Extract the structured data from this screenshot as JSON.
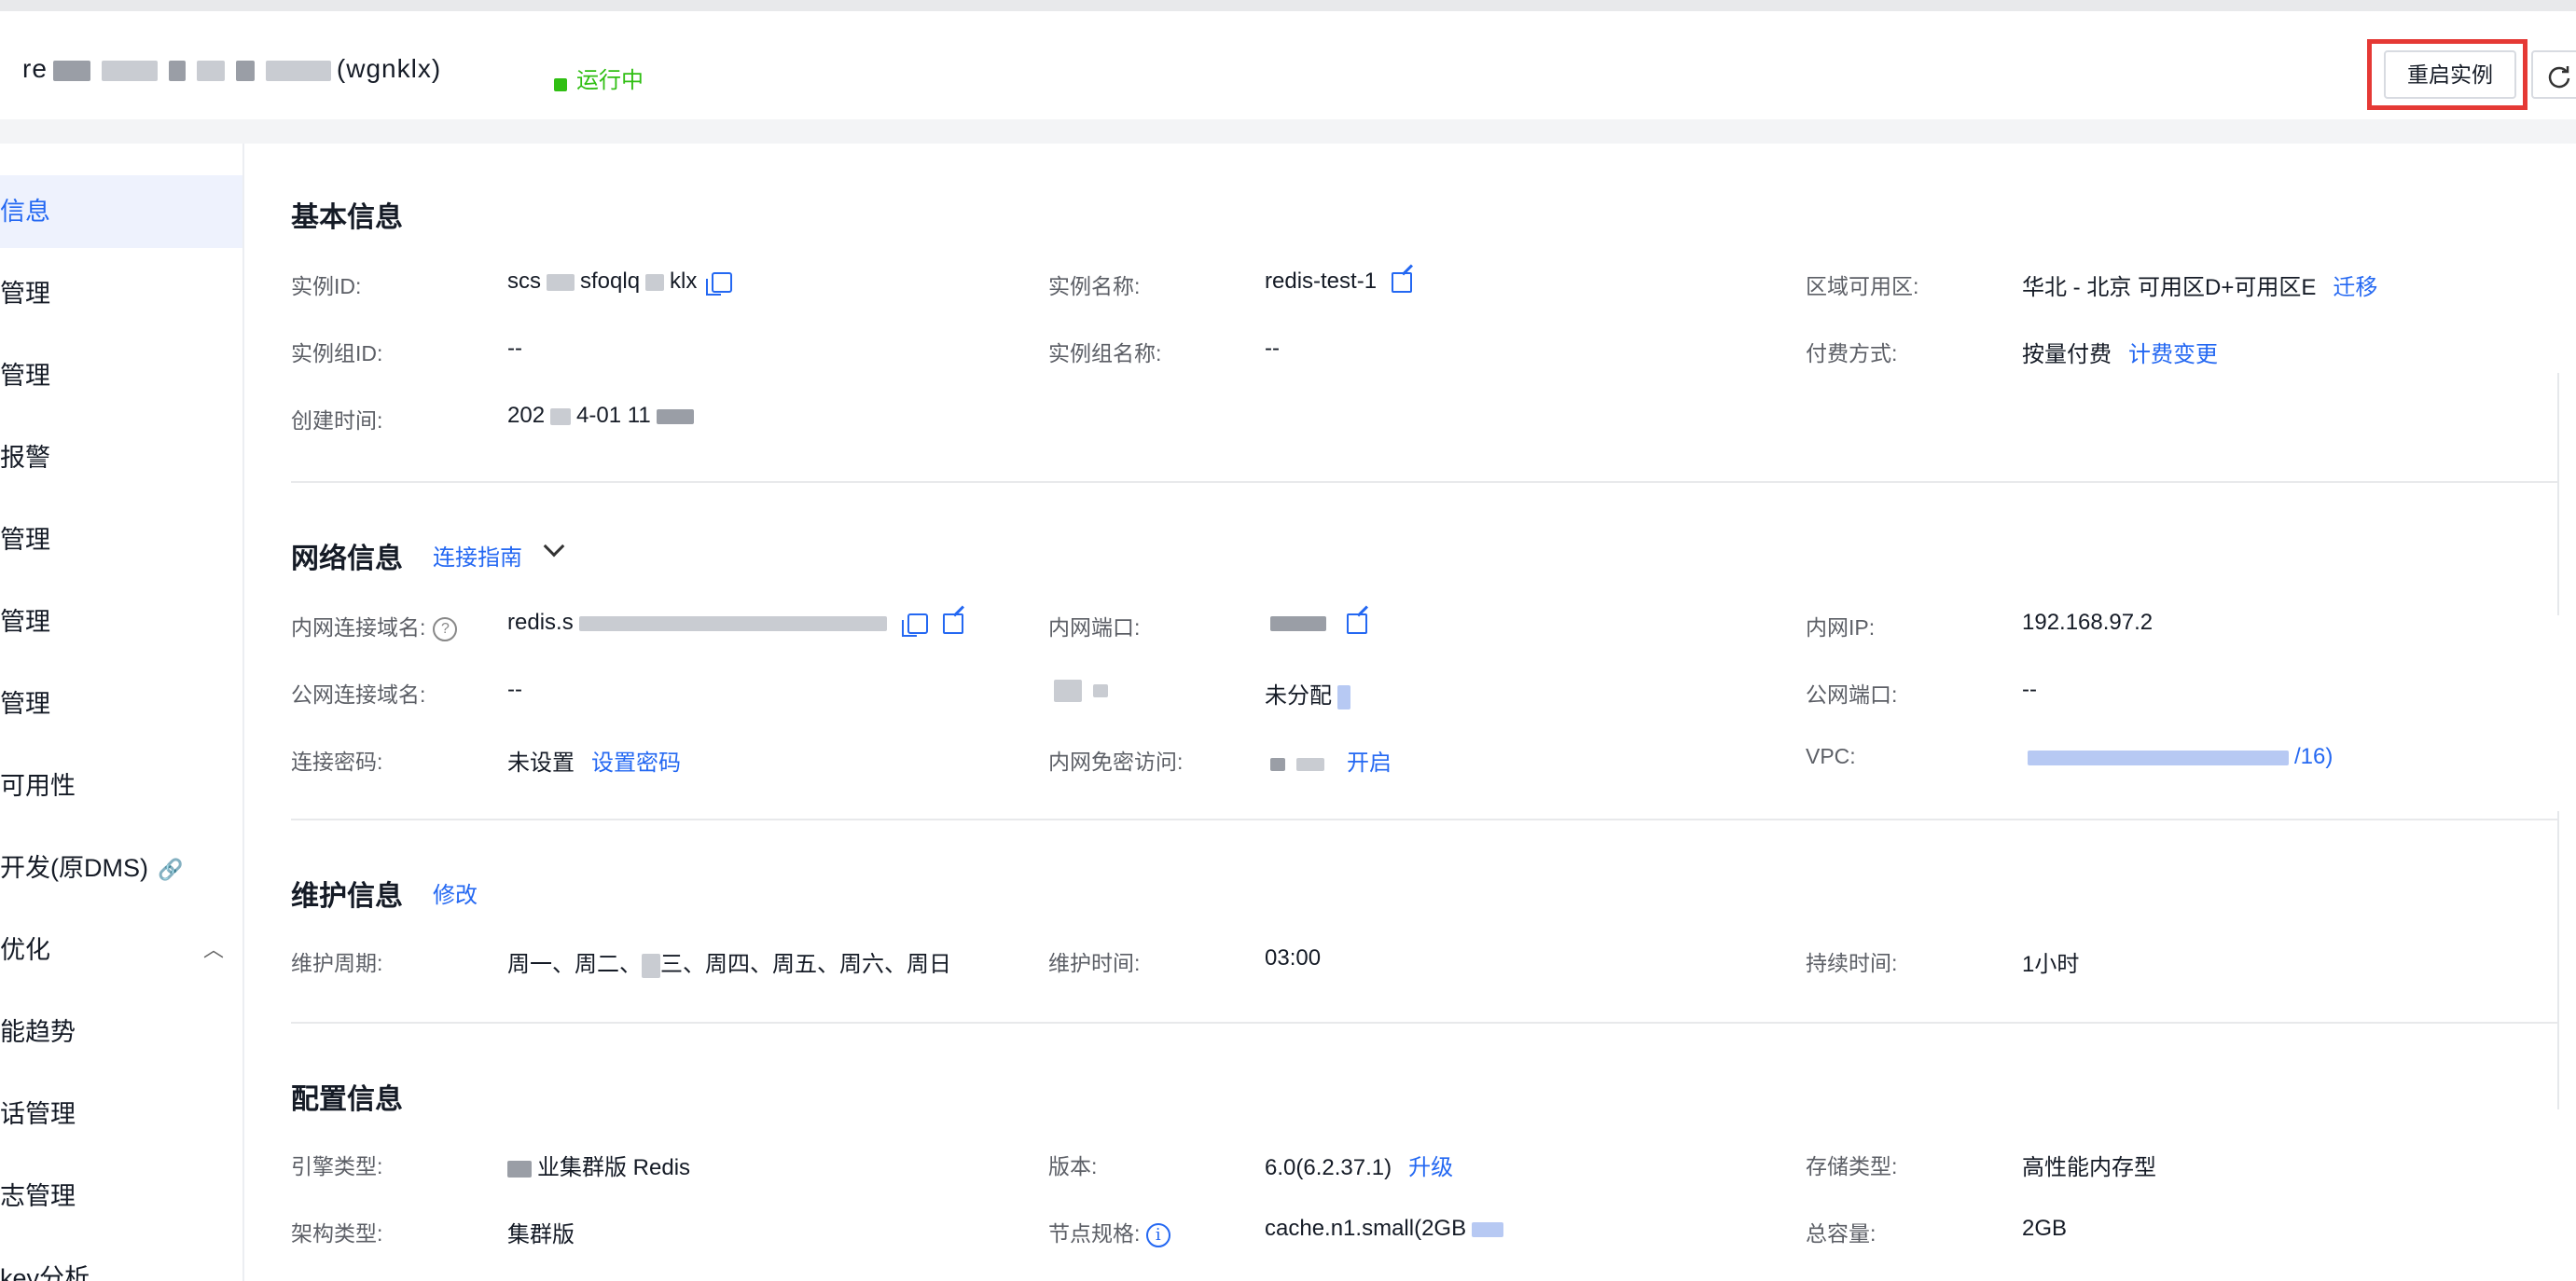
{
  "header": {
    "instance_title": "re",
    "instance_title_suffix": "(wgnklx)",
    "status": "运行中",
    "restart_button": "重启实例"
  },
  "sidebar": {
    "items": [
      {
        "label": "信息",
        "active": true
      },
      {
        "label": "管理"
      },
      {
        "label": "管理"
      },
      {
        "label": "报警"
      },
      {
        "label": "管理"
      },
      {
        "label": "管理"
      },
      {
        "label": "管理"
      },
      {
        "label": "可用性"
      },
      {
        "label": "开发(原DMS)"
      },
      {
        "label": "优化"
      },
      {
        "label": "能趋势"
      },
      {
        "label": "话管理"
      },
      {
        "label": "志管理"
      },
      {
        "label": "key分析"
      }
    ]
  },
  "basic": {
    "title": "基本信息",
    "instance_id_label": "实例ID:",
    "instance_id_value_a": "scs",
    "instance_id_value_b": "sfoqlq",
    "instance_id_value_c": "klx",
    "instance_name_label": "实例名称:",
    "instance_name_value": "redis-test-1",
    "region_label": "区域可用区:",
    "region_value": "华北 - 北京 可用区D+可用区E",
    "region_link": "迁移",
    "group_id_label": "实例组ID:",
    "group_id_value": "--",
    "group_name_label": "实例组名称:",
    "group_name_value": "--",
    "billing_label": "付费方式:",
    "billing_value": "按量付费",
    "billing_link": "计费变更",
    "created_label": "创建时间:",
    "created_value_a": "202",
    "created_value_b": "4-01 11"
  },
  "network": {
    "title": "网络信息",
    "guide_link": "连接指南",
    "private_domain_label": "内网连接域名:",
    "private_domain_value": "redis.s",
    "private_port_label": "内网端口:",
    "private_ip_label": "内网IP:",
    "private_ip_value": "192.168.97.2",
    "public_domain_label": "公网连接域名:",
    "public_domain_value": "--",
    "public_ip_value": "未分配",
    "public_port_label": "公网端口:",
    "public_port_value": "--",
    "password_label": "连接密码:",
    "password_value": "未设置",
    "password_link": "设置密码",
    "nopass_label": "内网免密访问:",
    "nopass_link": "开启",
    "vpc_label": "VPC:",
    "vpc_value_suffix": "/16)"
  },
  "maintenance": {
    "title": "维护信息",
    "edit_link": "修改",
    "period_label": "维护周期:",
    "period_value_a": "周一、周二、",
    "period_value_b": "三、周四、周五、周六、周日",
    "time_label": "维护时间:",
    "time_value": "03:00",
    "duration_label": "持续时间:",
    "duration_value": "1小时"
  },
  "config": {
    "title": "配置信息",
    "engine_label": "引擎类型:",
    "engine_value": "业集群版 Redis",
    "version_label": "版本:",
    "version_value": "6.0(6.2.37.1)",
    "upgrade_link": "升级",
    "storage_label": "存储类型:",
    "storage_value": "高性能内存型",
    "arch_label": "架构类型:",
    "arch_value": "集群版",
    "node_spec_label": "节点规格:",
    "node_spec_value": "cache.n1.small(2GB",
    "total_label": "总容量:",
    "total_value": "2GB"
  }
}
